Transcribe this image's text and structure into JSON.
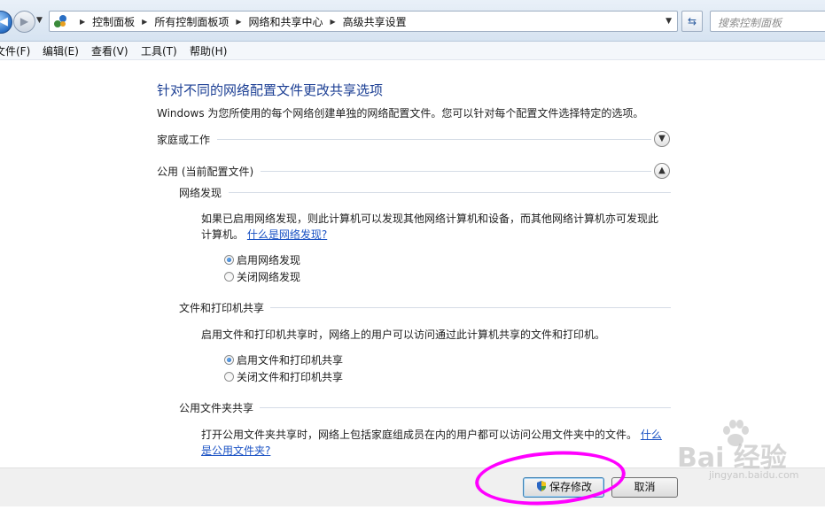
{
  "addressbar": {
    "breadcrumbs": [
      "控制面板",
      "所有控制面板项",
      "网络和共享中心",
      "高级共享设置"
    ],
    "search_placeholder": "搜索控制面板"
  },
  "menubar": {
    "items": [
      "文件(F)",
      "编辑(E)",
      "查看(V)",
      "工具(T)",
      "帮助(H)"
    ]
  },
  "main": {
    "title": "针对不同的网络配置文件更改共享选项",
    "description": "Windows 为您所使用的每个网络创建单独的网络配置文件。您可以针对每个配置文件选择特定的选项。",
    "profiles": [
      {
        "name": "家庭或工作",
        "expanded": false
      },
      {
        "name": "公用 (当前配置文件)",
        "expanded": true
      }
    ],
    "network_discovery": {
      "title": "网络发现",
      "text_line1": "如果已启用网络发现，则此计算机可以发现其他网络计算机和设备，而其他网络计算机亦可发现此",
      "text_line2": "计算机。",
      "link": "什么是网络发现?",
      "options": [
        "启用网络发现",
        "关闭网络发现"
      ],
      "selected": 0
    },
    "file_printer_sharing": {
      "title": "文件和打印机共享",
      "text": "启用文件和打印机共享时，网络上的用户可以访问通过此计算机共享的文件和打印机。",
      "options": [
        "启用文件和打印机共享",
        "关闭文件和打印机共享"
      ],
      "selected": 0
    },
    "public_folder_sharing": {
      "title": "公用文件夹共享",
      "text_line1": "打开公用文件夹共享时，网络上包括家庭组成员在内的用户都可以访问公用文件夹中的文件。",
      "link_part1": "什么",
      "link_part2": "是公用文件夹?"
    }
  },
  "footer": {
    "save_label": "保存修改",
    "cancel_label": "取消"
  },
  "watermark": {
    "text": "Bai 经验",
    "url": "jingyan.baidu.com"
  },
  "colors": {
    "title_blue": "#1c3f94",
    "link_blue": "#1a52c4",
    "highlight": "#ff00ff"
  }
}
